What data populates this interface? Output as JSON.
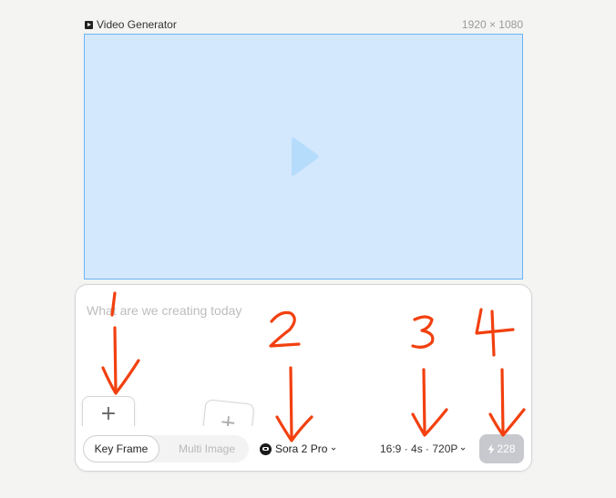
{
  "frame": {
    "title": "Video Generator",
    "size_label": "1920 × 1080",
    "icon": "video-icon"
  },
  "canvas": {
    "background": "#d3e8fd",
    "border": "#6bb5f5",
    "icon": "play-icon"
  },
  "prompt": {
    "placeholder": "What are we creating today",
    "value": ""
  },
  "frames": {
    "slot_1_label": "+",
    "slot_2_label": "+"
  },
  "mode": {
    "keyframe_label": "Key Frame",
    "multi_image_label": "Multi Image",
    "selected": "Key Frame"
  },
  "model": {
    "label": "Sora 2 Pro",
    "icon": "openai-logo-icon"
  },
  "settings": {
    "label": "16:9 · 4s · 720P"
  },
  "generate": {
    "credits": "228",
    "icon": "bolt-icon",
    "background": "#c7c9ce"
  },
  "annotations": {
    "color": "#f2400f",
    "labels": [
      "1",
      "2",
      "3",
      "4"
    ]
  }
}
